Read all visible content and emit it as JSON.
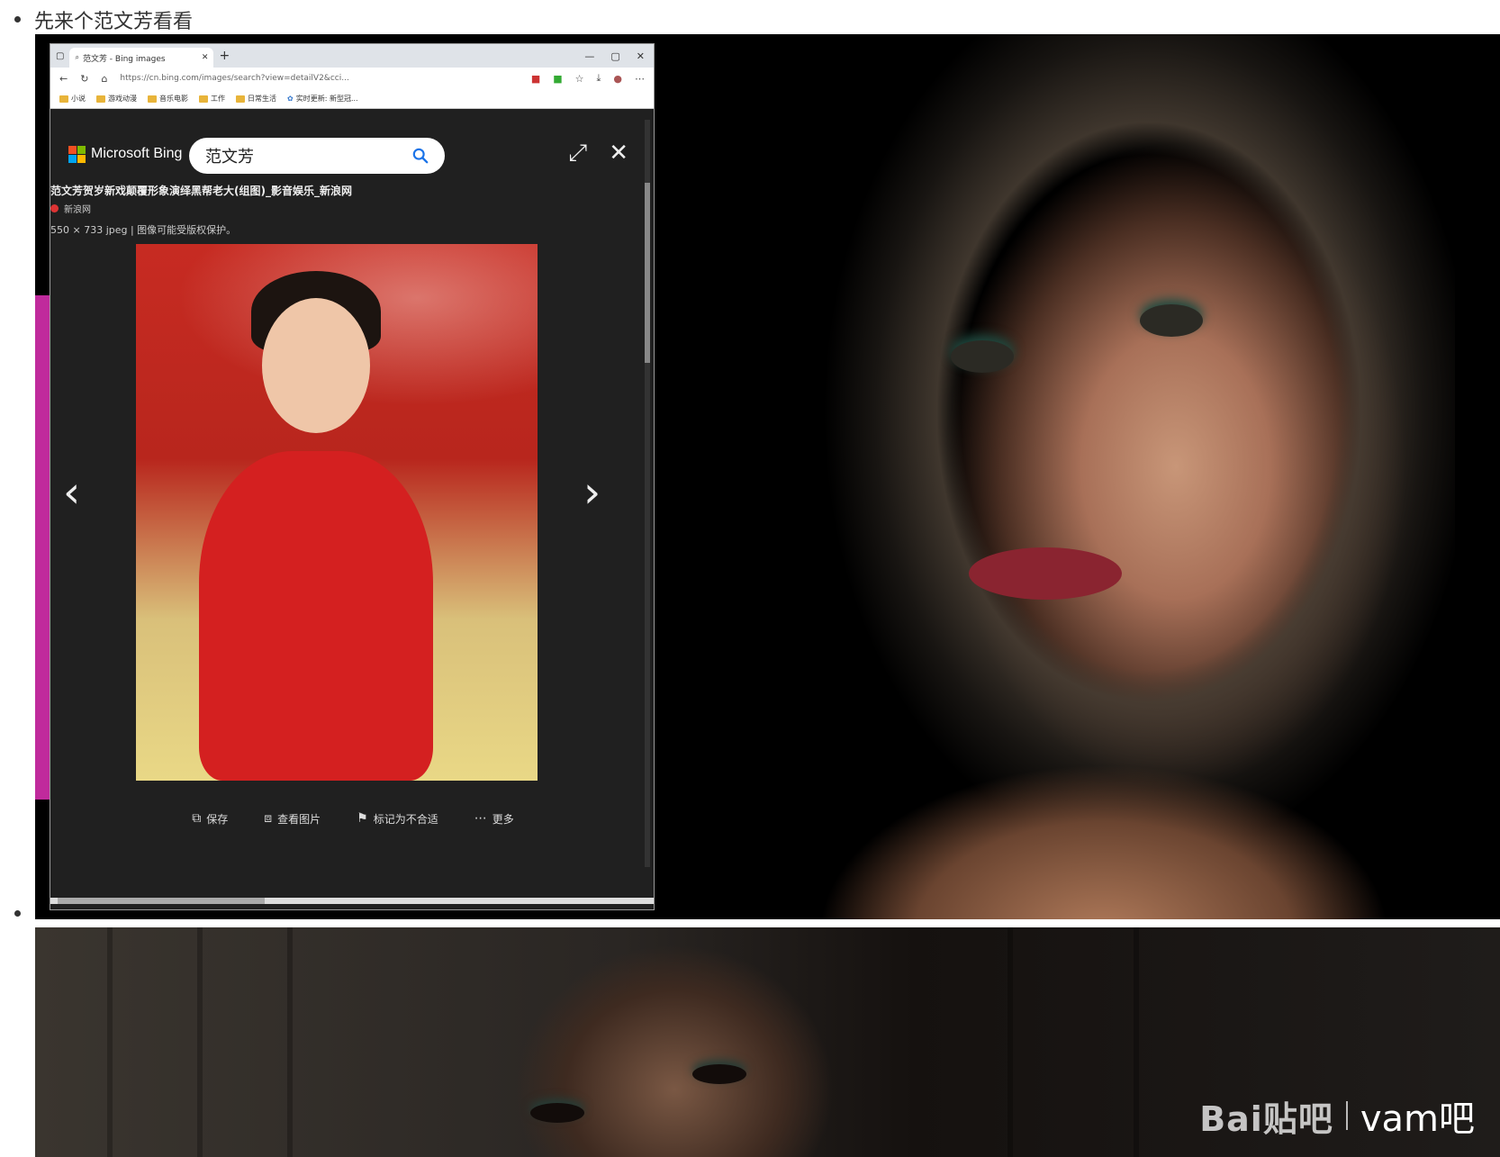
{
  "post": {
    "caption": "先来个范文芳看看"
  },
  "browser": {
    "tab_title": "范文芳 - Bing images",
    "url": "https://cn.bing.com/images/search?view=detailV2&cci...",
    "bookmarks": [
      "小说",
      "游戏动漫",
      "音乐电影",
      "工作",
      "日常生活",
      "实时更新: 新型冠..."
    ]
  },
  "bing": {
    "brand": "Microsoft Bing",
    "search_value": "范文芳",
    "image_title": "范文芳贺岁新戏颠覆形象演绎黑帮老大(组图)_影音娱乐_新浪网",
    "source": "新浪网",
    "info": "550 × 733 jpeg  |  图像可能受版权保护。",
    "actions": {
      "save": "保存",
      "view": "查看图片",
      "flag": "标记为不合适",
      "more": "更多"
    }
  },
  "watermark": {
    "brand": "Bai贴吧",
    "name": "vam吧"
  },
  "colors": {
    "ms_red": "#f25022",
    "ms_green": "#7fba00",
    "ms_blue": "#00a4ef",
    "ms_yellow": "#ffb900",
    "search_icon": "#1a73e8"
  }
}
